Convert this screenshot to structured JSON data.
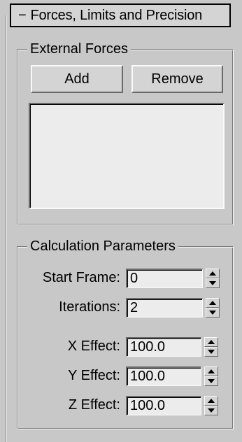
{
  "rollout": {
    "collapse_symbol": "−",
    "title": "Forces, Limits and Precision"
  },
  "external_forces": {
    "title": "External Forces",
    "add_label": "Add",
    "remove_label": "Remove",
    "items": []
  },
  "calculation": {
    "title": "Calculation Parameters",
    "start_frame": {
      "label": "Start Frame:",
      "value": "0"
    },
    "iterations": {
      "label": "Iterations:",
      "value": "2"
    },
    "x_effect": {
      "label": "X Effect:",
      "value": "100.0"
    },
    "y_effect": {
      "label": "Y Effect:",
      "value": "100.0"
    },
    "z_effect": {
      "label": "Z Effect:",
      "value": "100.0"
    }
  },
  "icons": {
    "spinner_up": "spinner-up-arrow-icon",
    "spinner_down": "spinner-down-arrow-icon"
  },
  "colors": {
    "panel_bg": "#c8c8c8",
    "button_face": "#d4d4d4",
    "field_bg": "#ececec"
  }
}
